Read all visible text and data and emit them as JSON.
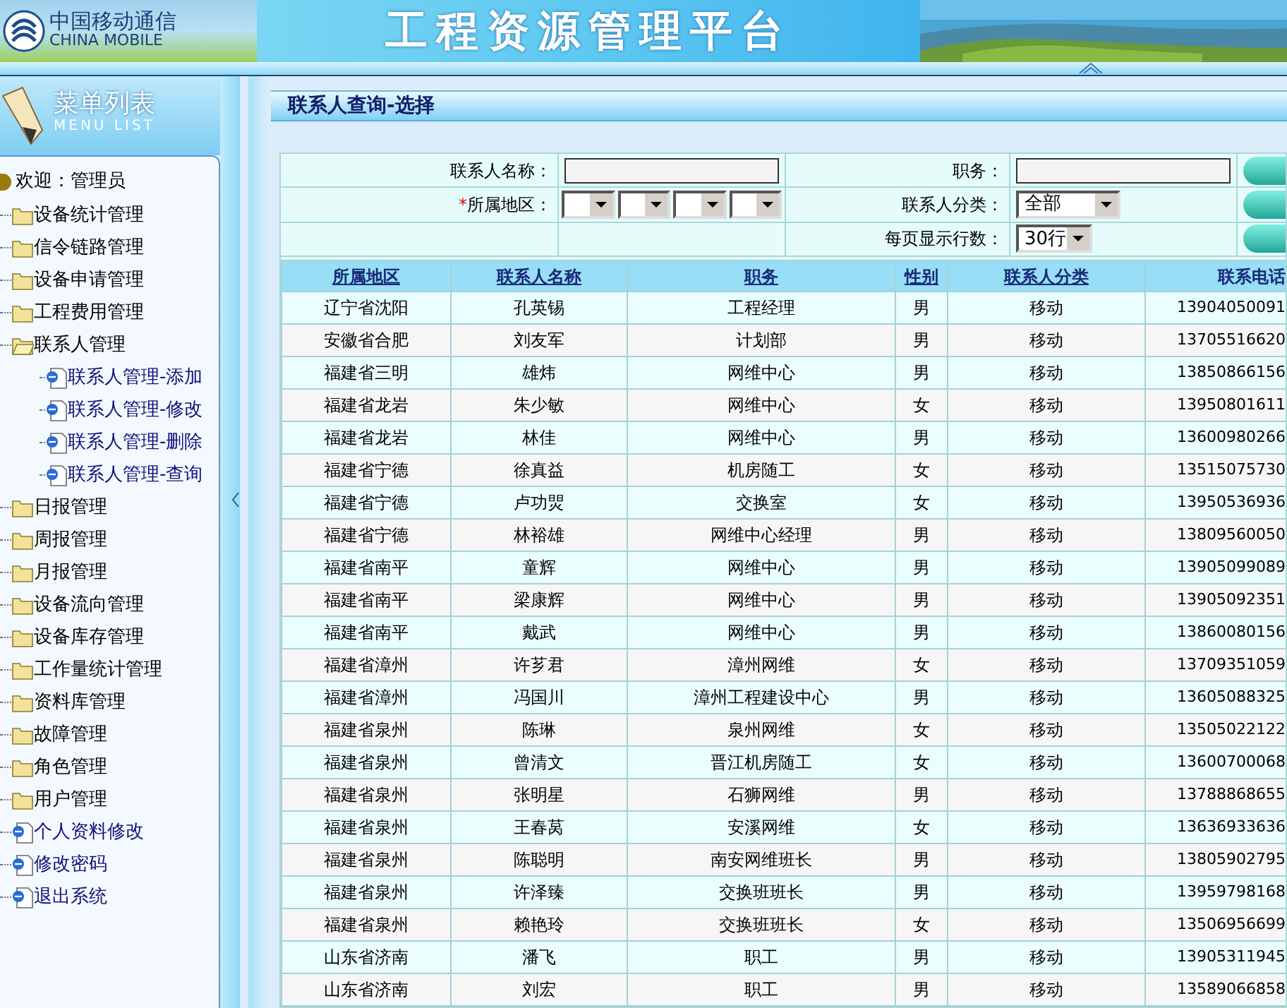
{
  "header": {
    "logo_cn": "中国移动通信",
    "logo_en": "CHINA MOBILE",
    "title": "工程资源管理平台"
  },
  "sidebar": {
    "title": "菜单列表",
    "subtitle": "MENU LIST",
    "welcome": "欢迎：管理员",
    "items": [
      {
        "label": "设备统计管理",
        "kind": "folder",
        "expanded": false
      },
      {
        "label": "信令链路管理",
        "kind": "folder",
        "expanded": false
      },
      {
        "label": "设备申请管理",
        "kind": "folder",
        "expanded": false
      },
      {
        "label": "工程费用管理",
        "kind": "folder",
        "expanded": false
      },
      {
        "label": "联系人管理",
        "kind": "folder",
        "expanded": true,
        "children": [
          {
            "label": "联系人管理-添加",
            "kind": "page"
          },
          {
            "label": "联系人管理-修改",
            "kind": "page"
          },
          {
            "label": "联系人管理-删除",
            "kind": "page"
          },
          {
            "label": "联系人管理-查询",
            "kind": "page"
          }
        ]
      },
      {
        "label": "日报管理",
        "kind": "folder",
        "expanded": false
      },
      {
        "label": "周报管理",
        "kind": "folder",
        "expanded": false
      },
      {
        "label": "月报管理",
        "kind": "folder",
        "expanded": false
      },
      {
        "label": "设备流向管理",
        "kind": "folder",
        "expanded": false
      },
      {
        "label": "设备库存管理",
        "kind": "folder",
        "expanded": false
      },
      {
        "label": "工作量统计管理",
        "kind": "folder",
        "expanded": false
      },
      {
        "label": "资料库管理",
        "kind": "folder",
        "expanded": false
      },
      {
        "label": "故障管理",
        "kind": "folder",
        "expanded": false
      },
      {
        "label": "角色管理",
        "kind": "folder",
        "expanded": false
      },
      {
        "label": "用户管理",
        "kind": "folder",
        "expanded": false
      },
      {
        "label": "个人资料修改",
        "kind": "page"
      },
      {
        "label": "修改密码",
        "kind": "page"
      },
      {
        "label": "退出系统",
        "kind": "page"
      }
    ]
  },
  "page_title": "联系人查询-选择",
  "form": {
    "name_label": "联系人名称：",
    "duty_label": "职务：",
    "region_label": "所属地区：",
    "required_mark": "*",
    "category_label": "联系人分类：",
    "category_value": "全部",
    "rows_label": "每页显示行数：",
    "rows_value": "30行"
  },
  "table": {
    "columns": [
      "所属地区",
      "联系人名称",
      "职务",
      "性别",
      "联系人分类",
      "联系电话"
    ],
    "rows": [
      [
        "辽宁省沈阳",
        "孔英锡",
        "工程经理",
        "男",
        "移动",
        "13904050091"
      ],
      [
        "安徽省合肥",
        "刘友军",
        "计划部",
        "男",
        "移动",
        "13705516620"
      ],
      [
        "福建省三明",
        "雄炜",
        "网维中心",
        "男",
        "移动",
        "13850866156"
      ],
      [
        "福建省龙岩",
        "朱少敏",
        "网维中心",
        "女",
        "移动",
        "13950801611"
      ],
      [
        "福建省龙岩",
        "林佳",
        "网维中心",
        "男",
        "移动",
        "13600980266"
      ],
      [
        "福建省宁德",
        "徐真益",
        "机房随工",
        "女",
        "移动",
        "13515075730"
      ],
      [
        "福建省宁德",
        "卢功焸",
        "交换室",
        "女",
        "移动",
        "13950536936"
      ],
      [
        "福建省宁德",
        "林裕雄",
        "网维中心经理",
        "男",
        "移动",
        "13809560050"
      ],
      [
        "福建省南平",
        "童辉",
        "网维中心",
        "男",
        "移动",
        "13905099089"
      ],
      [
        "福建省南平",
        "梁康辉",
        "网维中心",
        "男",
        "移动",
        "13905092351"
      ],
      [
        "福建省南平",
        "戴武",
        "网维中心",
        "男",
        "移动",
        "13860080156"
      ],
      [
        "福建省漳州",
        "许芗君",
        "漳州网维",
        "女",
        "移动",
        "13709351059"
      ],
      [
        "福建省漳州",
        "冯国川",
        "漳州工程建设中心",
        "男",
        "移动",
        "13605088325"
      ],
      [
        "福建省泉州",
        "陈琳",
        "泉州网维",
        "女",
        "移动",
        "13505022122"
      ],
      [
        "福建省泉州",
        "曾清文",
        "晋江机房随工",
        "女",
        "移动",
        "13600700068"
      ],
      [
        "福建省泉州",
        "张明星",
        "石狮网维",
        "男",
        "移动",
        "13788868655"
      ],
      [
        "福建省泉州",
        "王春莴",
        "安溪网维",
        "女",
        "移动",
        "13636933636"
      ],
      [
        "福建省泉州",
        "陈聪明",
        "南安网维班长",
        "男",
        "移动",
        "13805902795"
      ],
      [
        "福建省泉州",
        "许泽臻",
        "交换班班长",
        "男",
        "移动",
        "13959798168"
      ],
      [
        "福建省泉州",
        "赖艳玲",
        "交换班班长",
        "女",
        "移动",
        "13506956699"
      ],
      [
        "山东省济南",
        "潘飞",
        "职工",
        "男",
        "移动",
        "13905311945"
      ],
      [
        "山东省济南",
        "刘宏",
        "职工",
        "男",
        "移动",
        "13589066858"
      ]
    ]
  }
}
